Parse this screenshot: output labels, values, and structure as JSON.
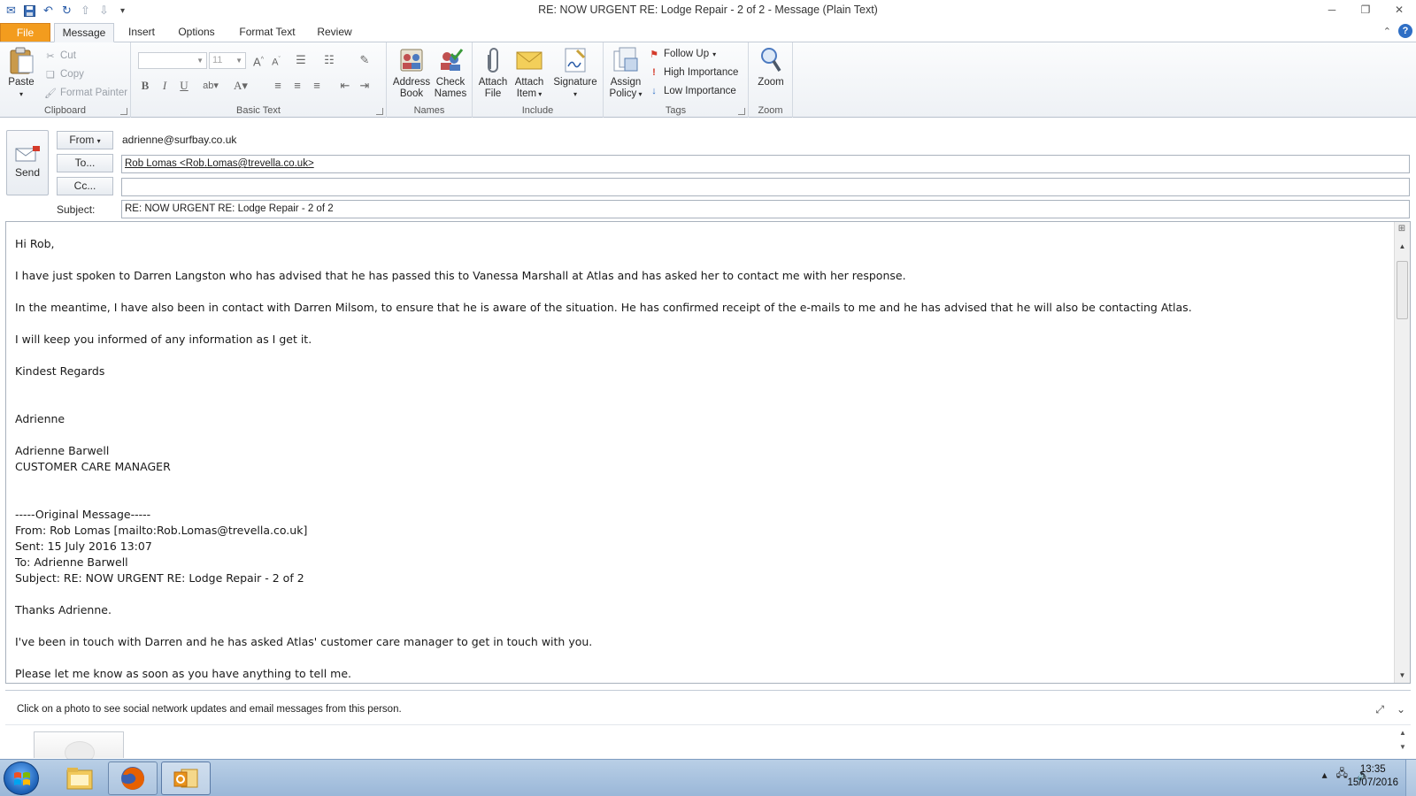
{
  "window": {
    "title": "RE: NOW URGENT   RE: Lodge Repair - 2 of 2  -  Message (Plain Text)"
  },
  "tabs": [
    {
      "label": "File"
    },
    {
      "label": "Message"
    },
    {
      "label": "Insert"
    },
    {
      "label": "Options"
    },
    {
      "label": "Format Text"
    },
    {
      "label": "Review"
    }
  ],
  "ribbon": {
    "clipboard": {
      "paste": "Paste",
      "cut": "Cut",
      "copy": "Copy",
      "format_painter": "Format Painter",
      "label": "Clipboard"
    },
    "basic_text": {
      "font_size": "11",
      "label": "Basic Text"
    },
    "names": {
      "address_book_1": "Address",
      "address_book_2": "Book",
      "check_names_1": "Check",
      "check_names_2": "Names",
      "label": "Names"
    },
    "include": {
      "attach_file_1": "Attach",
      "attach_file_2": "File",
      "attach_item_1": "Attach",
      "attach_item_2": "Item",
      "signature": "Signature",
      "label": "Include"
    },
    "tags": {
      "assign_policy_1": "Assign",
      "assign_policy_2": "Policy",
      "follow_up": "Follow Up",
      "high_importance": "High Importance",
      "low_importance": "Low Importance",
      "label": "Tags"
    },
    "zoom": {
      "zoom": "Zoom",
      "label": "Zoom"
    }
  },
  "header": {
    "send": "Send",
    "from_label": "From",
    "from_value": "adrienne@surfbay.co.uk",
    "to_label": "To...",
    "to_value": "Rob Lomas <Rob.Lomas@trevella.co.uk>",
    "cc_label": "Cc...",
    "cc_value": "",
    "subject_label": "Subject:",
    "subject_value": "RE: NOW URGENT   RE: Lodge Repair - 2 of 2"
  },
  "body": {
    "greeting": "Hi Rob,",
    "p1": "I have just spoken to Darren Langston who has advised that he has passed this to Vanessa Marshall at Atlas and has asked her to contact me with her response.",
    "p2": "In the meantime, I have also been in contact with Darren Milsom, to ensure that he is aware of the situation.  He has confirmed receipt of the e-mails to me and he has advised that he will also be contacting Atlas.",
    "p3": "I will keep you informed of any information as I get it.",
    "signoff": "Kindest Regards",
    "name_short": "Adrienne",
    "name_full": "Adrienne Barwell",
    "job_title": "CUSTOMER CARE MANAGER",
    "orig_header": "-----Original Message-----",
    "orig_from": "From: Rob Lomas [mailto:Rob.Lomas@trevella.co.uk]",
    "orig_sent": "Sent: 15 July 2016 13:07",
    "orig_to": "To: Adrienne Barwell",
    "orig_subject": "Subject: RE: NOW URGENT RE: Lodge Repair - 2 of 2",
    "orig_p1": "Thanks Adrienne.",
    "orig_p2": "I've been in touch with Darren and he has asked Atlas' customer care manager to get in touch with you.",
    "orig_p3": "Please let me know as soon as you have anything to tell me."
  },
  "people_pane": {
    "text": "Click on a photo to see social network updates and email messages from this person."
  },
  "taskbar": {
    "time": "13:35",
    "date": "15/07/2016"
  }
}
